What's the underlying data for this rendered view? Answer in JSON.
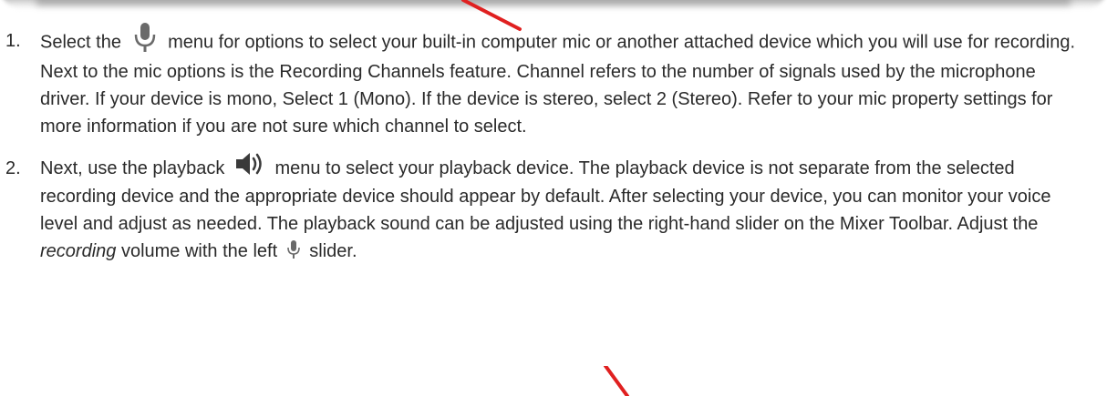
{
  "steps": [
    {
      "number": "1.",
      "icon": "microphone-icon",
      "text_before": "Select the",
      "text_after": "menu for options to select your built-in computer mic or another attached device which you will use for recording. Next to the mic options is the Recording Channels feature. Channel refers to the number of signals used by the microphone driver. If your device is mono, Select 1 (Mono). If the device is stereo, select 2 (Stereo). Refer to your mic property settings for more information if you are not sure which channel to select."
    },
    {
      "number": "2.",
      "icon": "speaker-icon",
      "text_before": "Next, use the playback",
      "text_after": "menu to select your playback device. The playback device is not separate from the selected recording device and the appropriate device should appear by default. After selecting your device, you can monitor your voice level and adjust as needed. The playback sound can be adjusted using the right-hand slider on the Mixer Toolbar. Adjust the",
      "emphasis": "recording",
      "text_mid": "volume with the left",
      "inline_icon": "microphone-icon",
      "text_end": "slider."
    }
  ],
  "colors": {
    "text": "#2a2a2a",
    "arrow": "#e02020",
    "icon": "#6a6a6a"
  }
}
